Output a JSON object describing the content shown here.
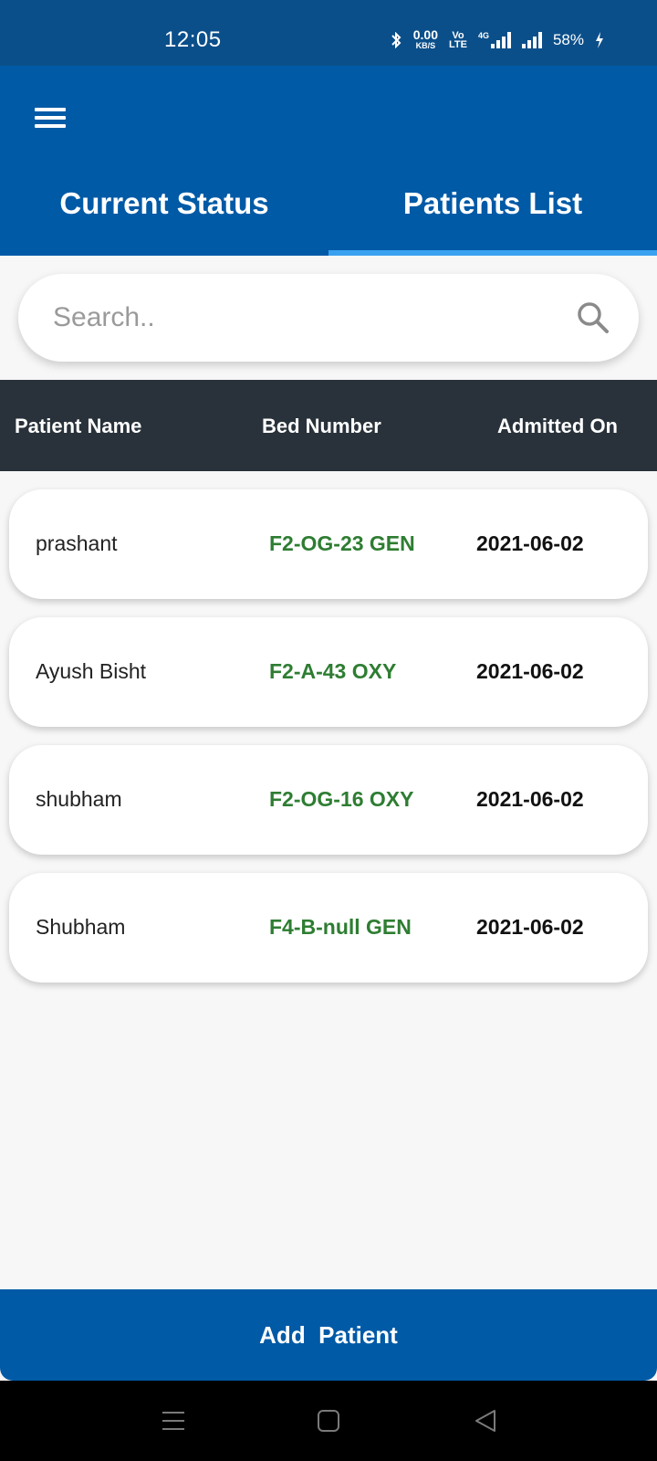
{
  "status_bar": {
    "time": "12:05",
    "data_speed_value": "0.00",
    "data_speed_unit": "KB/S",
    "volte_top": "Vo",
    "volte_bottom": "LTE",
    "network": "4G",
    "battery": "58%",
    "icons": [
      "bluetooth-icon",
      "signal-icon",
      "battery-charging-icon"
    ]
  },
  "app_bar": {
    "menu_icon": "hamburger-menu-icon",
    "tabs": [
      {
        "label": "Current Status",
        "selected": false
      },
      {
        "label": "Patients List",
        "selected": true
      }
    ],
    "colors": {
      "bar": "#005aa6",
      "indicator": "#3aa0f0"
    }
  },
  "search": {
    "placeholder": "Search..",
    "value": "",
    "icon": "search-icon"
  },
  "table": {
    "headers": [
      "Patient Name",
      "Bed Number",
      "Admitted On"
    ],
    "header_bg": "#29323a",
    "bed_color": "#2e7d32",
    "rows": [
      {
        "name": "prashant",
        "bed": "F2-OG-23 GEN",
        "admitted": "2021-06-02"
      },
      {
        "name": "Ayush Bisht",
        "bed": "F2-A-43 OXY",
        "admitted": "2021-06-02"
      },
      {
        "name": "shubham",
        "bed": "F2-OG-16 OXY",
        "admitted": "2021-06-02"
      },
      {
        "name": "Shubham",
        "bed": "F4-B-null GEN",
        "admitted": "2021-06-02"
      }
    ]
  },
  "actions": {
    "add_patient": "Add  Patient"
  },
  "nav_bar": {
    "icons": [
      "recent-apps-icon",
      "home-icon",
      "back-icon"
    ]
  }
}
